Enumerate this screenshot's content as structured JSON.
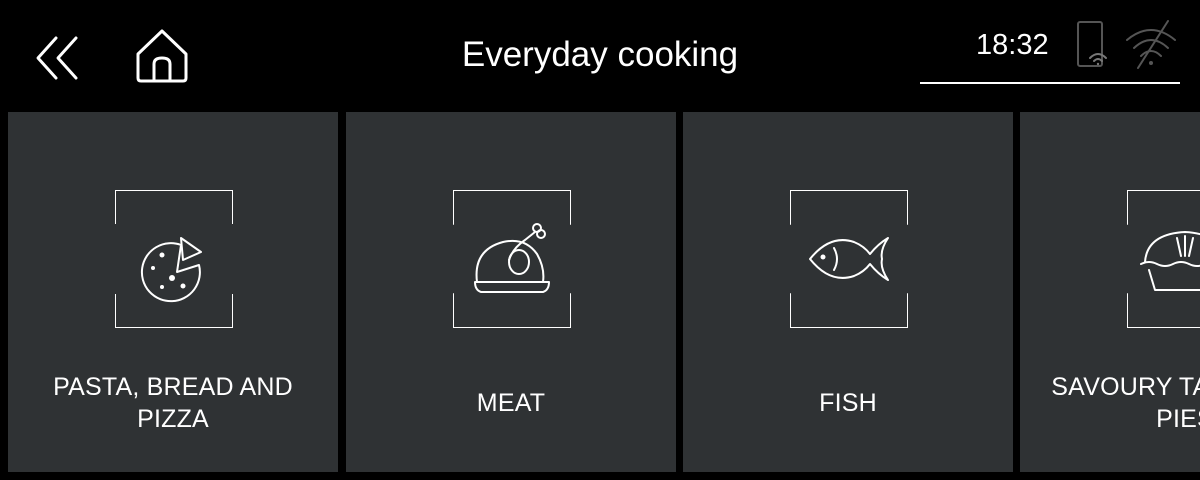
{
  "header": {
    "title": "Everyday cooking",
    "back_icon": "double-chevron-left-icon",
    "home_icon": "home-icon"
  },
  "status": {
    "time": "18:32",
    "icons": [
      "phone-wifi-icon",
      "wifi-off-icon"
    ]
  },
  "categories": [
    {
      "label": "PASTA, BREAD AND PIZZA",
      "icon": "pizza-icon"
    },
    {
      "label": "MEAT",
      "icon": "roast-chicken-icon"
    },
    {
      "label": "FISH",
      "icon": "fish-icon"
    },
    {
      "label": "SAVOURY TARTS AND PIES",
      "icon": "pie-icon"
    }
  ],
  "colors": {
    "background": "#000000",
    "tile": "#2f3234",
    "foreground": "#ffffff"
  }
}
